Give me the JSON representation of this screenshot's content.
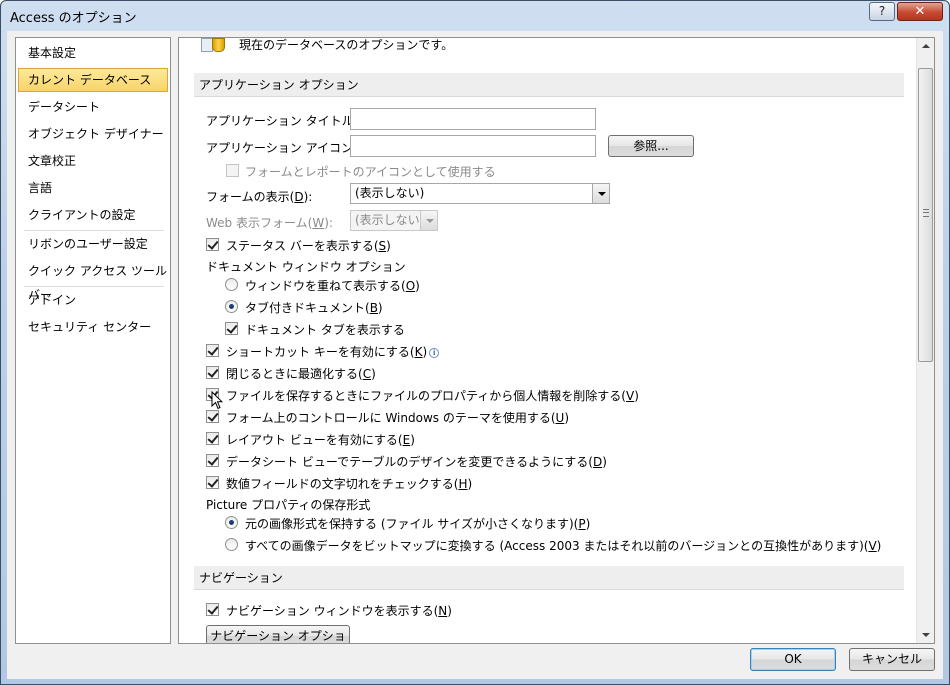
{
  "window": {
    "title": "Access のオプション",
    "help_label": "?",
    "close_label": "✕"
  },
  "nav": {
    "items": [
      {
        "label": "基本設定"
      },
      {
        "label": "カレント データベース"
      },
      {
        "label": "データシート"
      },
      {
        "label": "オブジェクト デザイナー"
      },
      {
        "label": "文章校正"
      },
      {
        "label": "言語"
      },
      {
        "label": "クライアントの設定"
      },
      {
        "label": "リボンのユーザー設定"
      },
      {
        "label": "クイック アクセス ツール バー"
      },
      {
        "label": "アドイン"
      },
      {
        "label": "セキュリティ センター"
      }
    ],
    "selected": "カレント データベース"
  },
  "content": {
    "intro_text": "現在のデータベースのオプションです。",
    "app_section": {
      "header": "アプリケーション オプション",
      "app_title": {
        "label": "アプリケーション タイトル(",
        "key": "T",
        "suffix": "):",
        "value": ""
      },
      "app_icon": {
        "label": "アプリケーション アイコン(",
        "key": "I",
        "suffix": "):",
        "value": "",
        "browse_label": "参照..."
      },
      "icon_for_forms": {
        "label": "フォームとレポートのアイコンとして使用する",
        "checked": false,
        "enabled": false
      },
      "display_form": {
        "label": "フォームの表示(",
        "key": "D",
        "suffix": "):",
        "value": "(表示しない)"
      },
      "web_display_form": {
        "label": "Web 表示フォーム(",
        "key": "W",
        "suffix": "):",
        "value": "(表示しない)",
        "enabled": false
      },
      "status_bar": {
        "label": "ステータス バーを表示する(",
        "key": "S",
        "suffix": ")",
        "checked": true
      },
      "doc_window_options": {
        "label": "ドキュメント ウィンドウ オプション",
        "overlapping": {
          "label": "ウィンドウを重ねて表示する(",
          "key": "O",
          "suffix": ")",
          "selected": false
        },
        "tabbed": {
          "label": "タブ付きドキュメント(",
          "key": "B",
          "suffix": ")",
          "selected": true
        },
        "show_tabs": {
          "label": "ドキュメント タブを表示する",
          "checked": true
        }
      },
      "shortcut_keys": {
        "label": "ショートカット キーを有効にする(",
        "key": "K",
        "suffix": ")",
        "checked": true,
        "info_icon": "i"
      },
      "compact_on_close": {
        "label": "閉じるときに最適化する(",
        "key": "C",
        "suffix": ")",
        "checked": true
      },
      "remove_personal_info": {
        "label": "ファイルを保存するときにファイルのプロパティから個人情報を削除する(",
        "key": "V",
        "suffix": ")",
        "checked": true
      },
      "windows_themes": {
        "label": "フォーム上のコントロールに Windows のテーマを使用する(",
        "key": "U",
        "suffix": ")",
        "checked": true
      },
      "layout_view": {
        "label": "レイアウト ビューを有効にする(",
        "key": "E",
        "suffix": ")",
        "checked": true
      },
      "datasheet_design": {
        "label": "データシート ビューでテーブルのデザインを変更できるようにする(",
        "key": "D",
        "suffix": ")",
        "checked": true
      },
      "truncated_fields": {
        "label": "数値フィールドの文字切れをチェックする(",
        "key": "H",
        "suffix": ")",
        "checked": true
      },
      "picture_format": {
        "label": "Picture プロパティの保存形式",
        "preserve": {
          "label": "元の画像形式を保持する (ファイル サイズが小さくなります)(",
          "key": "P",
          "suffix": ")",
          "selected": true
        },
        "convert": {
          "label": "すべての画像データをビットマップに変換する (Access 2003 またはそれ以前のバージョンとの互換性があります)(",
          "key": "V",
          "suffix": ")",
          "selected": false
        }
      }
    },
    "nav_section": {
      "header": "ナビゲーション",
      "show_nav": {
        "label": "ナビゲーション ウィンドウを表示する(",
        "key": "N",
        "suffix": ")",
        "checked": true
      },
      "nav_options_label": "ナビゲーション オプション..."
    }
  },
  "footer": {
    "ok_label": "OK",
    "cancel_label": "キャンセル"
  }
}
